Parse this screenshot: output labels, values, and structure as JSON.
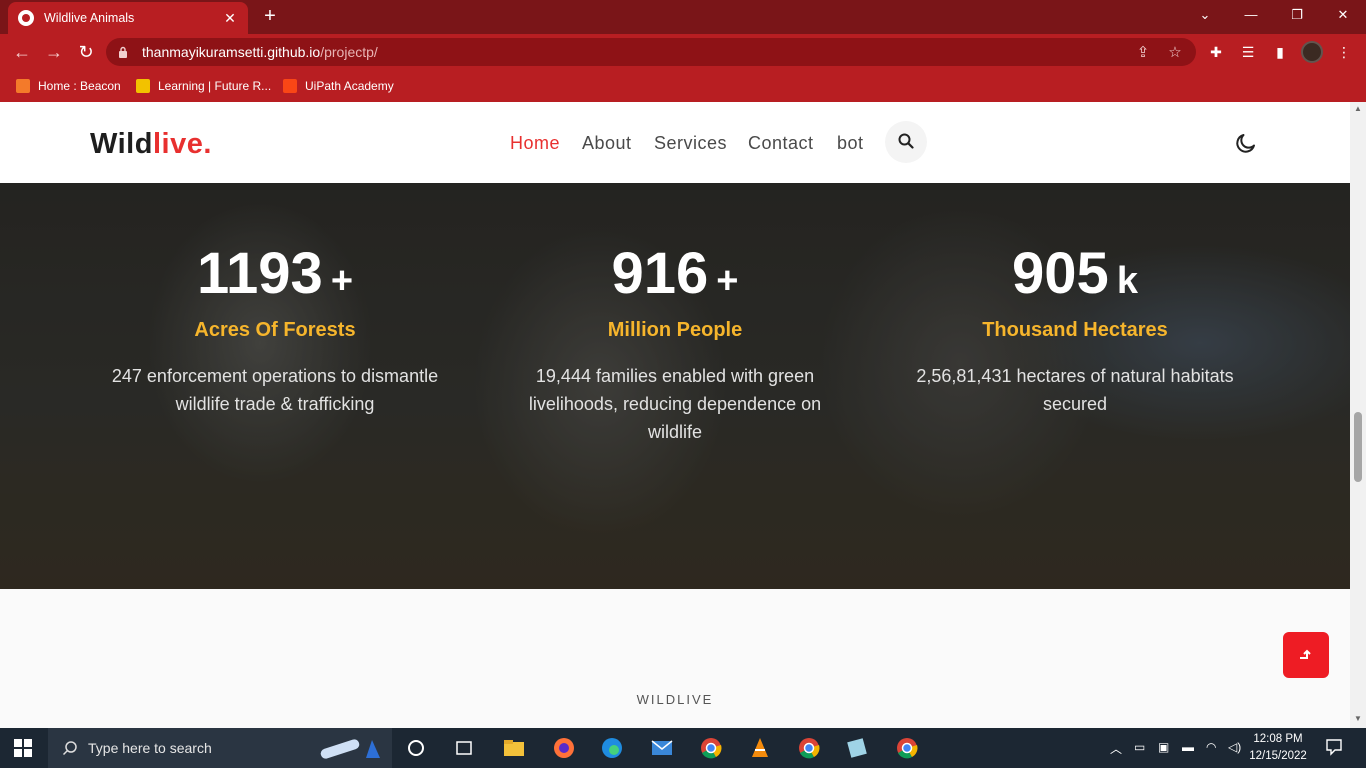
{
  "browser": {
    "tab_title": "Wildlive Animals",
    "url_host": "thanmayikuramsetti.github.io",
    "url_path": "/projectp/",
    "bookmarks": [
      "Home : Beacon",
      "Learning | Future R...",
      "UiPath Academy"
    ]
  },
  "site": {
    "logo_main": "Wild",
    "logo_accent": "live.",
    "nav": [
      "Home",
      "About",
      "Services",
      "Contact",
      "bot"
    ],
    "active_nav": "Home",
    "accent_color": "#e8302f",
    "highlight_color": "#f6b52c"
  },
  "stats": [
    {
      "value": "1193",
      "suffix": "+",
      "label": "Acres Of Forests",
      "desc": "247 enforcement operations to dismantle wildlife trade & trafficking"
    },
    {
      "value": "916",
      "suffix": "+",
      "label": "Million People",
      "desc": "19,444 families enabled with green livelihoods, reducing dependence on wildlife"
    },
    {
      "value": "905",
      "suffix": "k",
      "label": "Thousand Hectares",
      "desc": "2,56,81,431 hectares of natural habitats secured"
    }
  ],
  "next_section_label": "WILDLIVE",
  "taskbar": {
    "search_placeholder": "Type here to search",
    "time": "12:08 PM",
    "date": "12/15/2022"
  }
}
